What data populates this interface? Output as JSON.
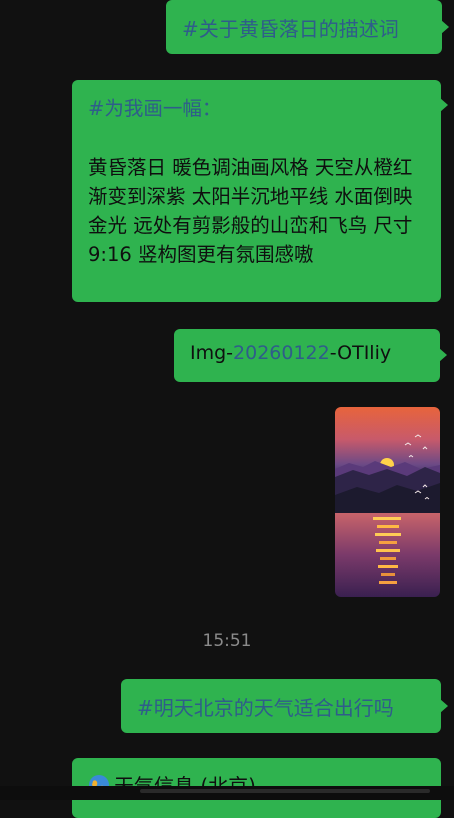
{
  "messages": {
    "m1": {
      "hash": "#",
      "text": "关于黄昏落日的描述词"
    },
    "m2": {
      "hash": "#",
      "head": "为我画一幅：",
      "body": "黄昏落日 暖色调油画风格 天空从橙红渐变到深紫 太阳半沉地平线 水面倒映金光 远处有剪影般的山峦和飞鸟 尺寸 9:16 竖构图更有氛围感嗷"
    },
    "m3": {
      "prefix": "Img-",
      "link": "20260122",
      "suffix": "-OTIliy"
    },
    "image": {
      "icon": "sunset-painting-image"
    },
    "timestamp": "15:51",
    "m4": {
      "hash": "#",
      "text": "明天北京的天气适合出行吗"
    },
    "m5": {
      "icon": "globe-icon",
      "text": "天气信息 (北京)"
    }
  },
  "colors": {
    "bubble": "#2fb34f",
    "background": "#111111",
    "hashtag": "#2f5d8a",
    "timestamp": "#8b8b8b"
  }
}
